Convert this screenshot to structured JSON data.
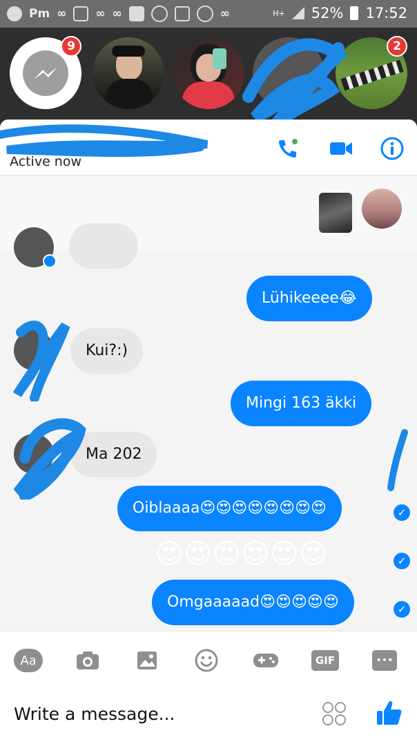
{
  "status_bar": {
    "left_text": "Pm",
    "network": "H+",
    "battery": "52%",
    "time": "17:52"
  },
  "chat_heads": [
    {
      "name": "messenger-home",
      "badge": "9"
    },
    {
      "name": "contact-1",
      "badge": ""
    },
    {
      "name": "contact-2",
      "badge": ""
    },
    {
      "name": "contact-3",
      "badge": ""
    },
    {
      "name": "contact-4",
      "badge": "2"
    }
  ],
  "conversation": {
    "status": "Active now"
  },
  "messages": [
    {
      "dir": "out",
      "text": "Lühikeeee😂"
    },
    {
      "dir": "in",
      "text": "Kui?:)"
    },
    {
      "dir": "out",
      "text": "Mingi 163 äkki"
    },
    {
      "dir": "in",
      "text": "Ma 202"
    },
    {
      "dir": "out",
      "text": "Oiblaaaa😍😍😍😍😍😍😍😍"
    },
    {
      "dir": "out",
      "text": "😍😍😍😍😍😍"
    },
    {
      "dir": "out",
      "text": "Omgaaaaad😍😍😍😍😍"
    }
  ],
  "toolbar": {
    "aa": "Aa",
    "gif": "GIF",
    "more": "•••"
  },
  "composer": {
    "placeholder": "Write a message..."
  },
  "colors": {
    "accent": "#0a84ff",
    "badge": "#e53935",
    "redaction": "#1e88e5"
  }
}
